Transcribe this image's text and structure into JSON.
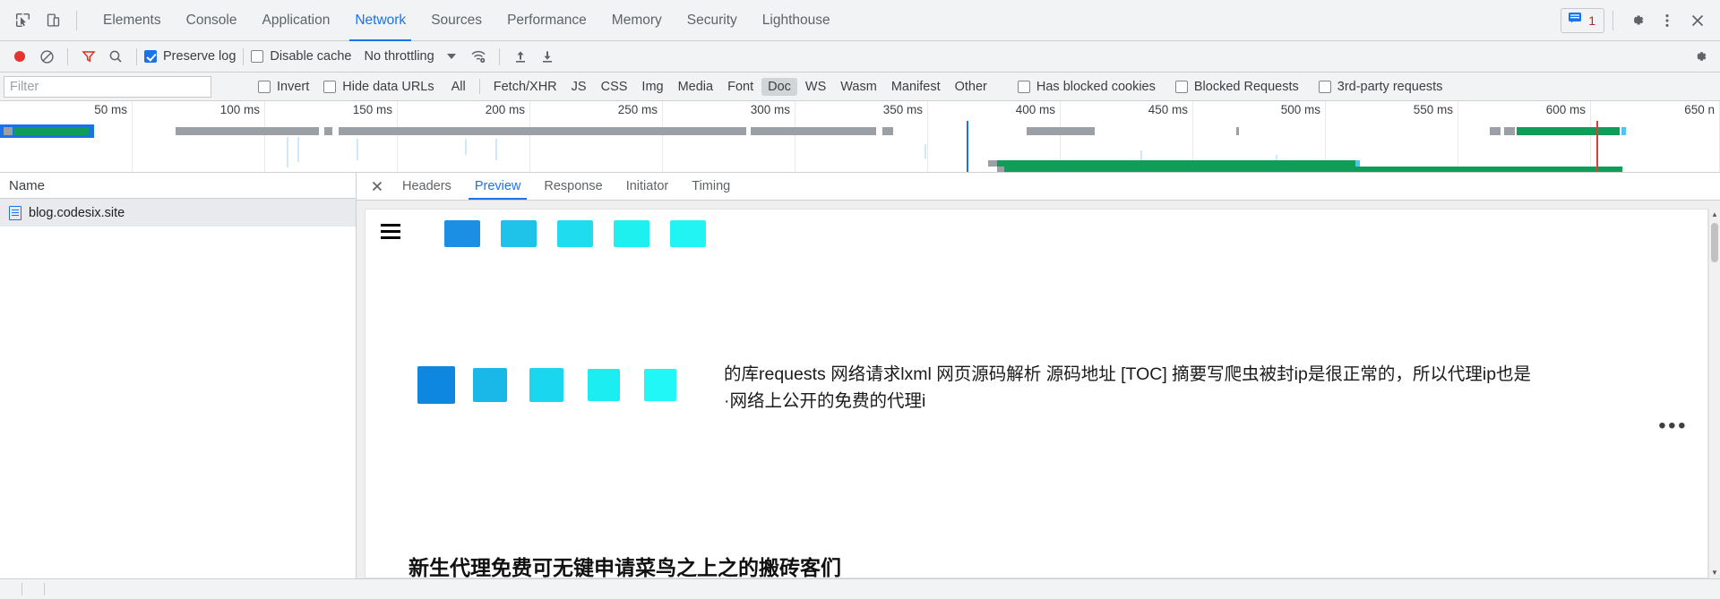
{
  "window": {
    "title": "DevTools"
  },
  "tabbar": {
    "inspect_icon": "inspect-cursor-icon",
    "device_icon": "device-toolbar-icon",
    "tabs": [
      {
        "label": "Elements",
        "active": false
      },
      {
        "label": "Console",
        "active": false
      },
      {
        "label": "Application",
        "active": false
      },
      {
        "label": "Network",
        "active": true
      },
      {
        "label": "Sources",
        "active": false
      },
      {
        "label": "Performance",
        "active": false
      },
      {
        "label": "Memory",
        "active": false
      },
      {
        "label": "Security",
        "active": false
      },
      {
        "label": "Lighthouse",
        "active": false
      }
    ],
    "message_count": "1",
    "message_icon": "console-message-icon",
    "settings_icon": "gear-icon",
    "more_icon": "more-vertical-icon",
    "close_icon": "close-icon"
  },
  "toolbar": {
    "record_icon": "record-circle-icon",
    "clear_icon": "clear-no-entry-icon",
    "filter_icon": "funnel-filter-icon",
    "search_icon": "search-icon",
    "preserve_log_label": "Preserve log",
    "preserve_log_checked": true,
    "disable_cache_label": "Disable cache",
    "disable_cache_checked": false,
    "throttling_value": "No throttling",
    "throttling_icon": "wifi-settings-icon",
    "import_icon": "import-arrow-up-icon",
    "export_icon": "export-arrow-down-icon",
    "settings_icon": "network-settings-gear-icon",
    "accent_color": "#1a73e8",
    "record_color": "#e3342f"
  },
  "filterbar": {
    "placeholder": "Filter",
    "value": "",
    "invert_label": "Invert",
    "invert_checked": false,
    "hide_data_urls_label": "Hide data URLs",
    "hide_data_urls_checked": false,
    "types": [
      {
        "label": "All",
        "active": false
      },
      {
        "label": "Fetch/XHR",
        "active": false
      },
      {
        "label": "JS",
        "active": false
      },
      {
        "label": "CSS",
        "active": false
      },
      {
        "label": "Img",
        "active": false
      },
      {
        "label": "Media",
        "active": false
      },
      {
        "label": "Font",
        "active": false
      },
      {
        "label": "Doc",
        "active": true
      },
      {
        "label": "WS",
        "active": false
      },
      {
        "label": "Wasm",
        "active": false
      },
      {
        "label": "Manifest",
        "active": false
      },
      {
        "label": "Other",
        "active": false
      }
    ],
    "has_blocked_cookies_label": "Has blocked cookies",
    "has_blocked_cookies_checked": false,
    "blocked_requests_label": "Blocked Requests",
    "blocked_requests_checked": false,
    "third_party_label": "3rd-party requests",
    "third_party_checked": false
  },
  "overview": {
    "ticks": [
      "50 ms",
      "100 ms",
      "150 ms",
      "200 ms",
      "250 ms",
      "300 ms",
      "350 ms",
      "400 ms",
      "450 ms",
      "500 ms",
      "550 ms",
      "600 ms",
      "650 n"
    ],
    "dcl_marker_color": "#1a73e8",
    "load_marker_color": "#e53935"
  },
  "requests": {
    "column_header": "Name",
    "rows": [
      {
        "name": "blog.codesix.site",
        "icon": "document-icon",
        "selected": true
      }
    ]
  },
  "detail": {
    "close_icon": "close-icon",
    "tabs": [
      {
        "label": "Headers",
        "active": false
      },
      {
        "label": "Preview",
        "active": true
      },
      {
        "label": "Response",
        "active": false
      },
      {
        "label": "Initiator",
        "active": false
      },
      {
        "label": "Timing",
        "active": false
      }
    ]
  },
  "preview": {
    "menu_icon": "hamburger-menu-icon",
    "top_swatches": [
      {
        "color": "#1a8fe3"
      },
      {
        "color": "#1fc2e8"
      },
      {
        "color": "#1fdcef"
      },
      {
        "color": "#1ef0f0"
      },
      {
        "color": "#22f4f4"
      }
    ],
    "mid_swatches": [
      {
        "color": "#0d87e0"
      },
      {
        "color": "#1ab8e8"
      },
      {
        "color": "#1ad6ee"
      },
      {
        "color": "#1bedf0"
      },
      {
        "color": "#22f7f7"
      }
    ],
    "body_text": "的库requests 网络请求lxml 网页源码解析 源码地址 [TOC] 摘要写爬虫被封ip是很正常的，所以代理ip也是\n·网络上公开的免费的代理i",
    "ellipsis": "•••",
    "bottom_text": "新生代理免费可无键申请菜鸟之上之的搬砖客们",
    "bottom_highlight_color": "#22d3ee",
    "scrollbar": {
      "up_arrow": "▲",
      "down_arrow": "▼"
    }
  }
}
